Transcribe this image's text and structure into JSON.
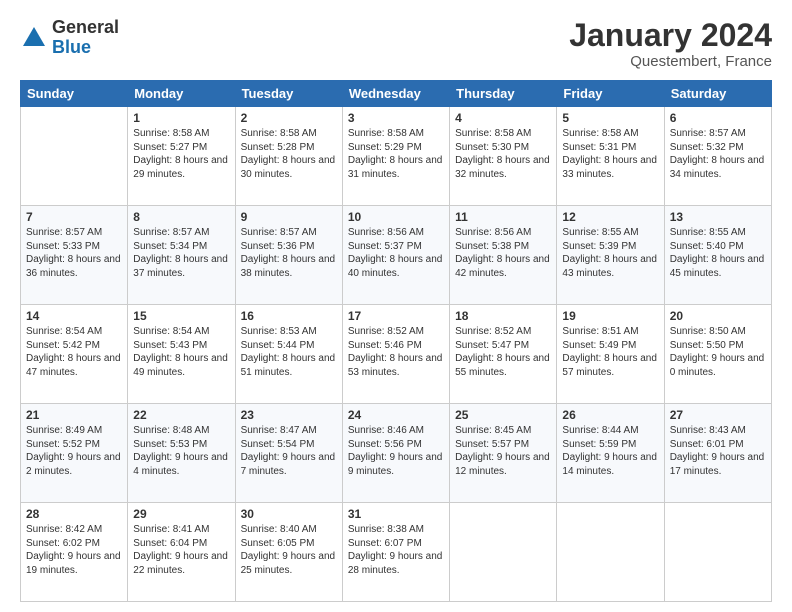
{
  "header": {
    "logo_general": "General",
    "logo_blue": "Blue",
    "title": "January 2024",
    "location": "Questembert, France"
  },
  "calendar": {
    "days_of_week": [
      "Sunday",
      "Monday",
      "Tuesday",
      "Wednesday",
      "Thursday",
      "Friday",
      "Saturday"
    ],
    "weeks": [
      [
        {
          "day": "",
          "sunrise": "",
          "sunset": "",
          "daylight": ""
        },
        {
          "day": "1",
          "sunrise": "Sunrise: 8:58 AM",
          "sunset": "Sunset: 5:27 PM",
          "daylight": "Daylight: 8 hours and 29 minutes."
        },
        {
          "day": "2",
          "sunrise": "Sunrise: 8:58 AM",
          "sunset": "Sunset: 5:28 PM",
          "daylight": "Daylight: 8 hours and 30 minutes."
        },
        {
          "day": "3",
          "sunrise": "Sunrise: 8:58 AM",
          "sunset": "Sunset: 5:29 PM",
          "daylight": "Daylight: 8 hours and 31 minutes."
        },
        {
          "day": "4",
          "sunrise": "Sunrise: 8:58 AM",
          "sunset": "Sunset: 5:30 PM",
          "daylight": "Daylight: 8 hours and 32 minutes."
        },
        {
          "day": "5",
          "sunrise": "Sunrise: 8:58 AM",
          "sunset": "Sunset: 5:31 PM",
          "daylight": "Daylight: 8 hours and 33 minutes."
        },
        {
          "day": "6",
          "sunrise": "Sunrise: 8:57 AM",
          "sunset": "Sunset: 5:32 PM",
          "daylight": "Daylight: 8 hours and 34 minutes."
        }
      ],
      [
        {
          "day": "7",
          "sunrise": "Sunrise: 8:57 AM",
          "sunset": "Sunset: 5:33 PM",
          "daylight": "Daylight: 8 hours and 36 minutes."
        },
        {
          "day": "8",
          "sunrise": "Sunrise: 8:57 AM",
          "sunset": "Sunset: 5:34 PM",
          "daylight": "Daylight: 8 hours and 37 minutes."
        },
        {
          "day": "9",
          "sunrise": "Sunrise: 8:57 AM",
          "sunset": "Sunset: 5:36 PM",
          "daylight": "Daylight: 8 hours and 38 minutes."
        },
        {
          "day": "10",
          "sunrise": "Sunrise: 8:56 AM",
          "sunset": "Sunset: 5:37 PM",
          "daylight": "Daylight: 8 hours and 40 minutes."
        },
        {
          "day": "11",
          "sunrise": "Sunrise: 8:56 AM",
          "sunset": "Sunset: 5:38 PM",
          "daylight": "Daylight: 8 hours and 42 minutes."
        },
        {
          "day": "12",
          "sunrise": "Sunrise: 8:55 AM",
          "sunset": "Sunset: 5:39 PM",
          "daylight": "Daylight: 8 hours and 43 minutes."
        },
        {
          "day": "13",
          "sunrise": "Sunrise: 8:55 AM",
          "sunset": "Sunset: 5:40 PM",
          "daylight": "Daylight: 8 hours and 45 minutes."
        }
      ],
      [
        {
          "day": "14",
          "sunrise": "Sunrise: 8:54 AM",
          "sunset": "Sunset: 5:42 PM",
          "daylight": "Daylight: 8 hours and 47 minutes."
        },
        {
          "day": "15",
          "sunrise": "Sunrise: 8:54 AM",
          "sunset": "Sunset: 5:43 PM",
          "daylight": "Daylight: 8 hours and 49 minutes."
        },
        {
          "day": "16",
          "sunrise": "Sunrise: 8:53 AM",
          "sunset": "Sunset: 5:44 PM",
          "daylight": "Daylight: 8 hours and 51 minutes."
        },
        {
          "day": "17",
          "sunrise": "Sunrise: 8:52 AM",
          "sunset": "Sunset: 5:46 PM",
          "daylight": "Daylight: 8 hours and 53 minutes."
        },
        {
          "day": "18",
          "sunrise": "Sunrise: 8:52 AM",
          "sunset": "Sunset: 5:47 PM",
          "daylight": "Daylight: 8 hours and 55 minutes."
        },
        {
          "day": "19",
          "sunrise": "Sunrise: 8:51 AM",
          "sunset": "Sunset: 5:49 PM",
          "daylight": "Daylight: 8 hours and 57 minutes."
        },
        {
          "day": "20",
          "sunrise": "Sunrise: 8:50 AM",
          "sunset": "Sunset: 5:50 PM",
          "daylight": "Daylight: 9 hours and 0 minutes."
        }
      ],
      [
        {
          "day": "21",
          "sunrise": "Sunrise: 8:49 AM",
          "sunset": "Sunset: 5:52 PM",
          "daylight": "Daylight: 9 hours and 2 minutes."
        },
        {
          "day": "22",
          "sunrise": "Sunrise: 8:48 AM",
          "sunset": "Sunset: 5:53 PM",
          "daylight": "Daylight: 9 hours and 4 minutes."
        },
        {
          "day": "23",
          "sunrise": "Sunrise: 8:47 AM",
          "sunset": "Sunset: 5:54 PM",
          "daylight": "Daylight: 9 hours and 7 minutes."
        },
        {
          "day": "24",
          "sunrise": "Sunrise: 8:46 AM",
          "sunset": "Sunset: 5:56 PM",
          "daylight": "Daylight: 9 hours and 9 minutes."
        },
        {
          "day": "25",
          "sunrise": "Sunrise: 8:45 AM",
          "sunset": "Sunset: 5:57 PM",
          "daylight": "Daylight: 9 hours and 12 minutes."
        },
        {
          "day": "26",
          "sunrise": "Sunrise: 8:44 AM",
          "sunset": "Sunset: 5:59 PM",
          "daylight": "Daylight: 9 hours and 14 minutes."
        },
        {
          "day": "27",
          "sunrise": "Sunrise: 8:43 AM",
          "sunset": "Sunset: 6:01 PM",
          "daylight": "Daylight: 9 hours and 17 minutes."
        }
      ],
      [
        {
          "day": "28",
          "sunrise": "Sunrise: 8:42 AM",
          "sunset": "Sunset: 6:02 PM",
          "daylight": "Daylight: 9 hours and 19 minutes."
        },
        {
          "day": "29",
          "sunrise": "Sunrise: 8:41 AM",
          "sunset": "Sunset: 6:04 PM",
          "daylight": "Daylight: 9 hours and 22 minutes."
        },
        {
          "day": "30",
          "sunrise": "Sunrise: 8:40 AM",
          "sunset": "Sunset: 6:05 PM",
          "daylight": "Daylight: 9 hours and 25 minutes."
        },
        {
          "day": "31",
          "sunrise": "Sunrise: 8:38 AM",
          "sunset": "Sunset: 6:07 PM",
          "daylight": "Daylight: 9 hours and 28 minutes."
        },
        {
          "day": "",
          "sunrise": "",
          "sunset": "",
          "daylight": ""
        },
        {
          "day": "",
          "sunrise": "",
          "sunset": "",
          "daylight": ""
        },
        {
          "day": "",
          "sunrise": "",
          "sunset": "",
          "daylight": ""
        }
      ]
    ]
  }
}
